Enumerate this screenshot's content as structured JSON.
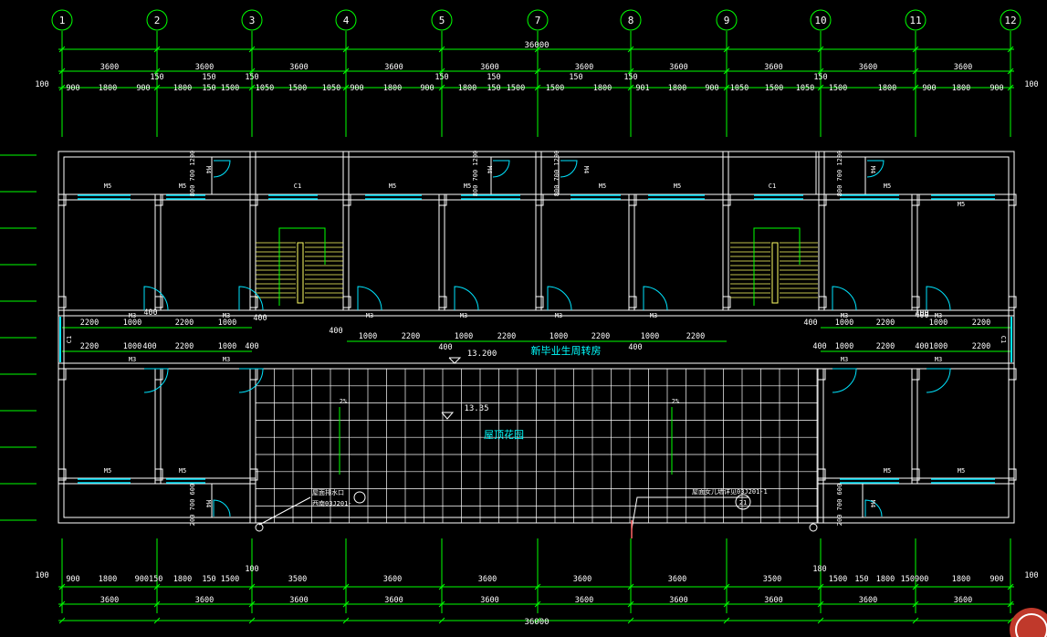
{
  "drawing": {
    "axes": [
      "1",
      "2",
      "3",
      "4",
      "5",
      "7",
      "8",
      "9",
      "10",
      "11",
      "12"
    ],
    "top_total": "36000",
    "bottom_total": "36000",
    "top_bays": [
      "3600",
      "3600",
      "3600",
      "3600",
      "3600",
      "3600",
      "3600",
      "3600",
      "3600",
      "3600"
    ],
    "top_detail": [
      "900",
      "1800",
      "900",
      "1800",
      "150",
      "1500",
      "1050",
      "1500",
      "1050",
      "900",
      "1800",
      "900",
      "1800",
      "150",
      "1500",
      "1500",
      "1800",
      "901",
      "1800",
      "900",
      "1050",
      "1500",
      "1050",
      "1500",
      "1800",
      "900",
      "1800",
      "900"
    ],
    "top_150s": [
      "150",
      "150",
      "150",
      "150",
      "150",
      "150",
      "150",
      "150"
    ],
    "side_100": "100",
    "bottom_bays": [
      "3600",
      "3600",
      "3600",
      "3600",
      "3600",
      "3600",
      "3600",
      "3600",
      "3600",
      "3600"
    ],
    "bottom_detail": [
      "900",
      "1800",
      "900150",
      "1800",
      "150",
      "1500",
      "3500",
      "3600",
      "3600",
      "3600",
      "3600",
      "3500",
      "1500",
      "150",
      "1800",
      "150900",
      "1800",
      "900"
    ],
    "bottom_100_left": "100",
    "bottom_100_mid": "100",
    "bottom_180": "180",
    "corridor_row1_left": [
      "2200",
      "1000",
      "2200",
      "1000"
    ],
    "corridor_row2_left": [
      "2200",
      "1000",
      "400",
      "2200",
      "1000",
      "400"
    ],
    "corridor_400s": [
      "400",
      "400",
      "400",
      "400",
      "400",
      "400",
      "400"
    ],
    "corridor_mid": [
      "1000",
      "2200",
      "1000",
      "2200",
      "1000",
      "2200",
      "1000",
      "2200"
    ],
    "corridor_row1_right": [
      "1000",
      "2200",
      "400",
      "1000",
      "2200"
    ],
    "corridor_row2_right": [
      "400",
      "1000",
      "2200",
      "400",
      "1000",
      "2200"
    ],
    "elev_1": "13.200",
    "elev_2": "13.35",
    "slope_1": "2%",
    "slope_2": "2%",
    "label_corridor": "新毕业生周转房",
    "label_roof_garden": "屋顶花园",
    "door_m5": "M5",
    "door_m3": "M3",
    "door_m4": "M4",
    "door_c1": "C1",
    "dim_vert": "800 700 1200",
    "dim_vert_bottom": "200 700 600",
    "note_left_1": "屋面排水口",
    "note_left_2": "西南03J201-",
    "note_right_1": "屋面女儿墙详见03J201-1",
    "note_right_2": "21",
    "window_label": "C1"
  }
}
